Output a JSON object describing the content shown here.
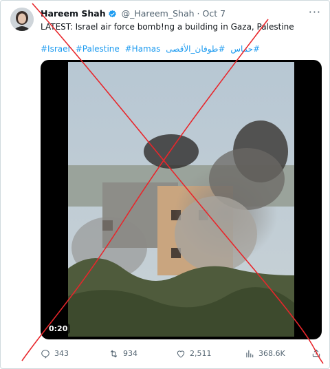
{
  "tweet": {
    "author_name": "Hareem Shah",
    "handle": "@_Hareem_Shah",
    "separator": "·",
    "date": "Oct 7",
    "more_label": "···",
    "text": "LATEST: Israel air force bomb!ng a building in Gaza, Palestine",
    "hashtags": [
      "#Israel",
      "#Palestine",
      "#Hamas",
      "#طوفان_الأقصى",
      "#حماس"
    ],
    "media": {
      "type": "video",
      "timestamp": "0:20"
    },
    "actions": {
      "replies": "343",
      "reposts": "934",
      "likes": "2,511",
      "views": "368.6K"
    },
    "colors": {
      "link": "#1d9bf0",
      "verified": "#1d9bf0",
      "secondary_text": "#536471",
      "overlay_cross": "#e8262b"
    }
  }
}
